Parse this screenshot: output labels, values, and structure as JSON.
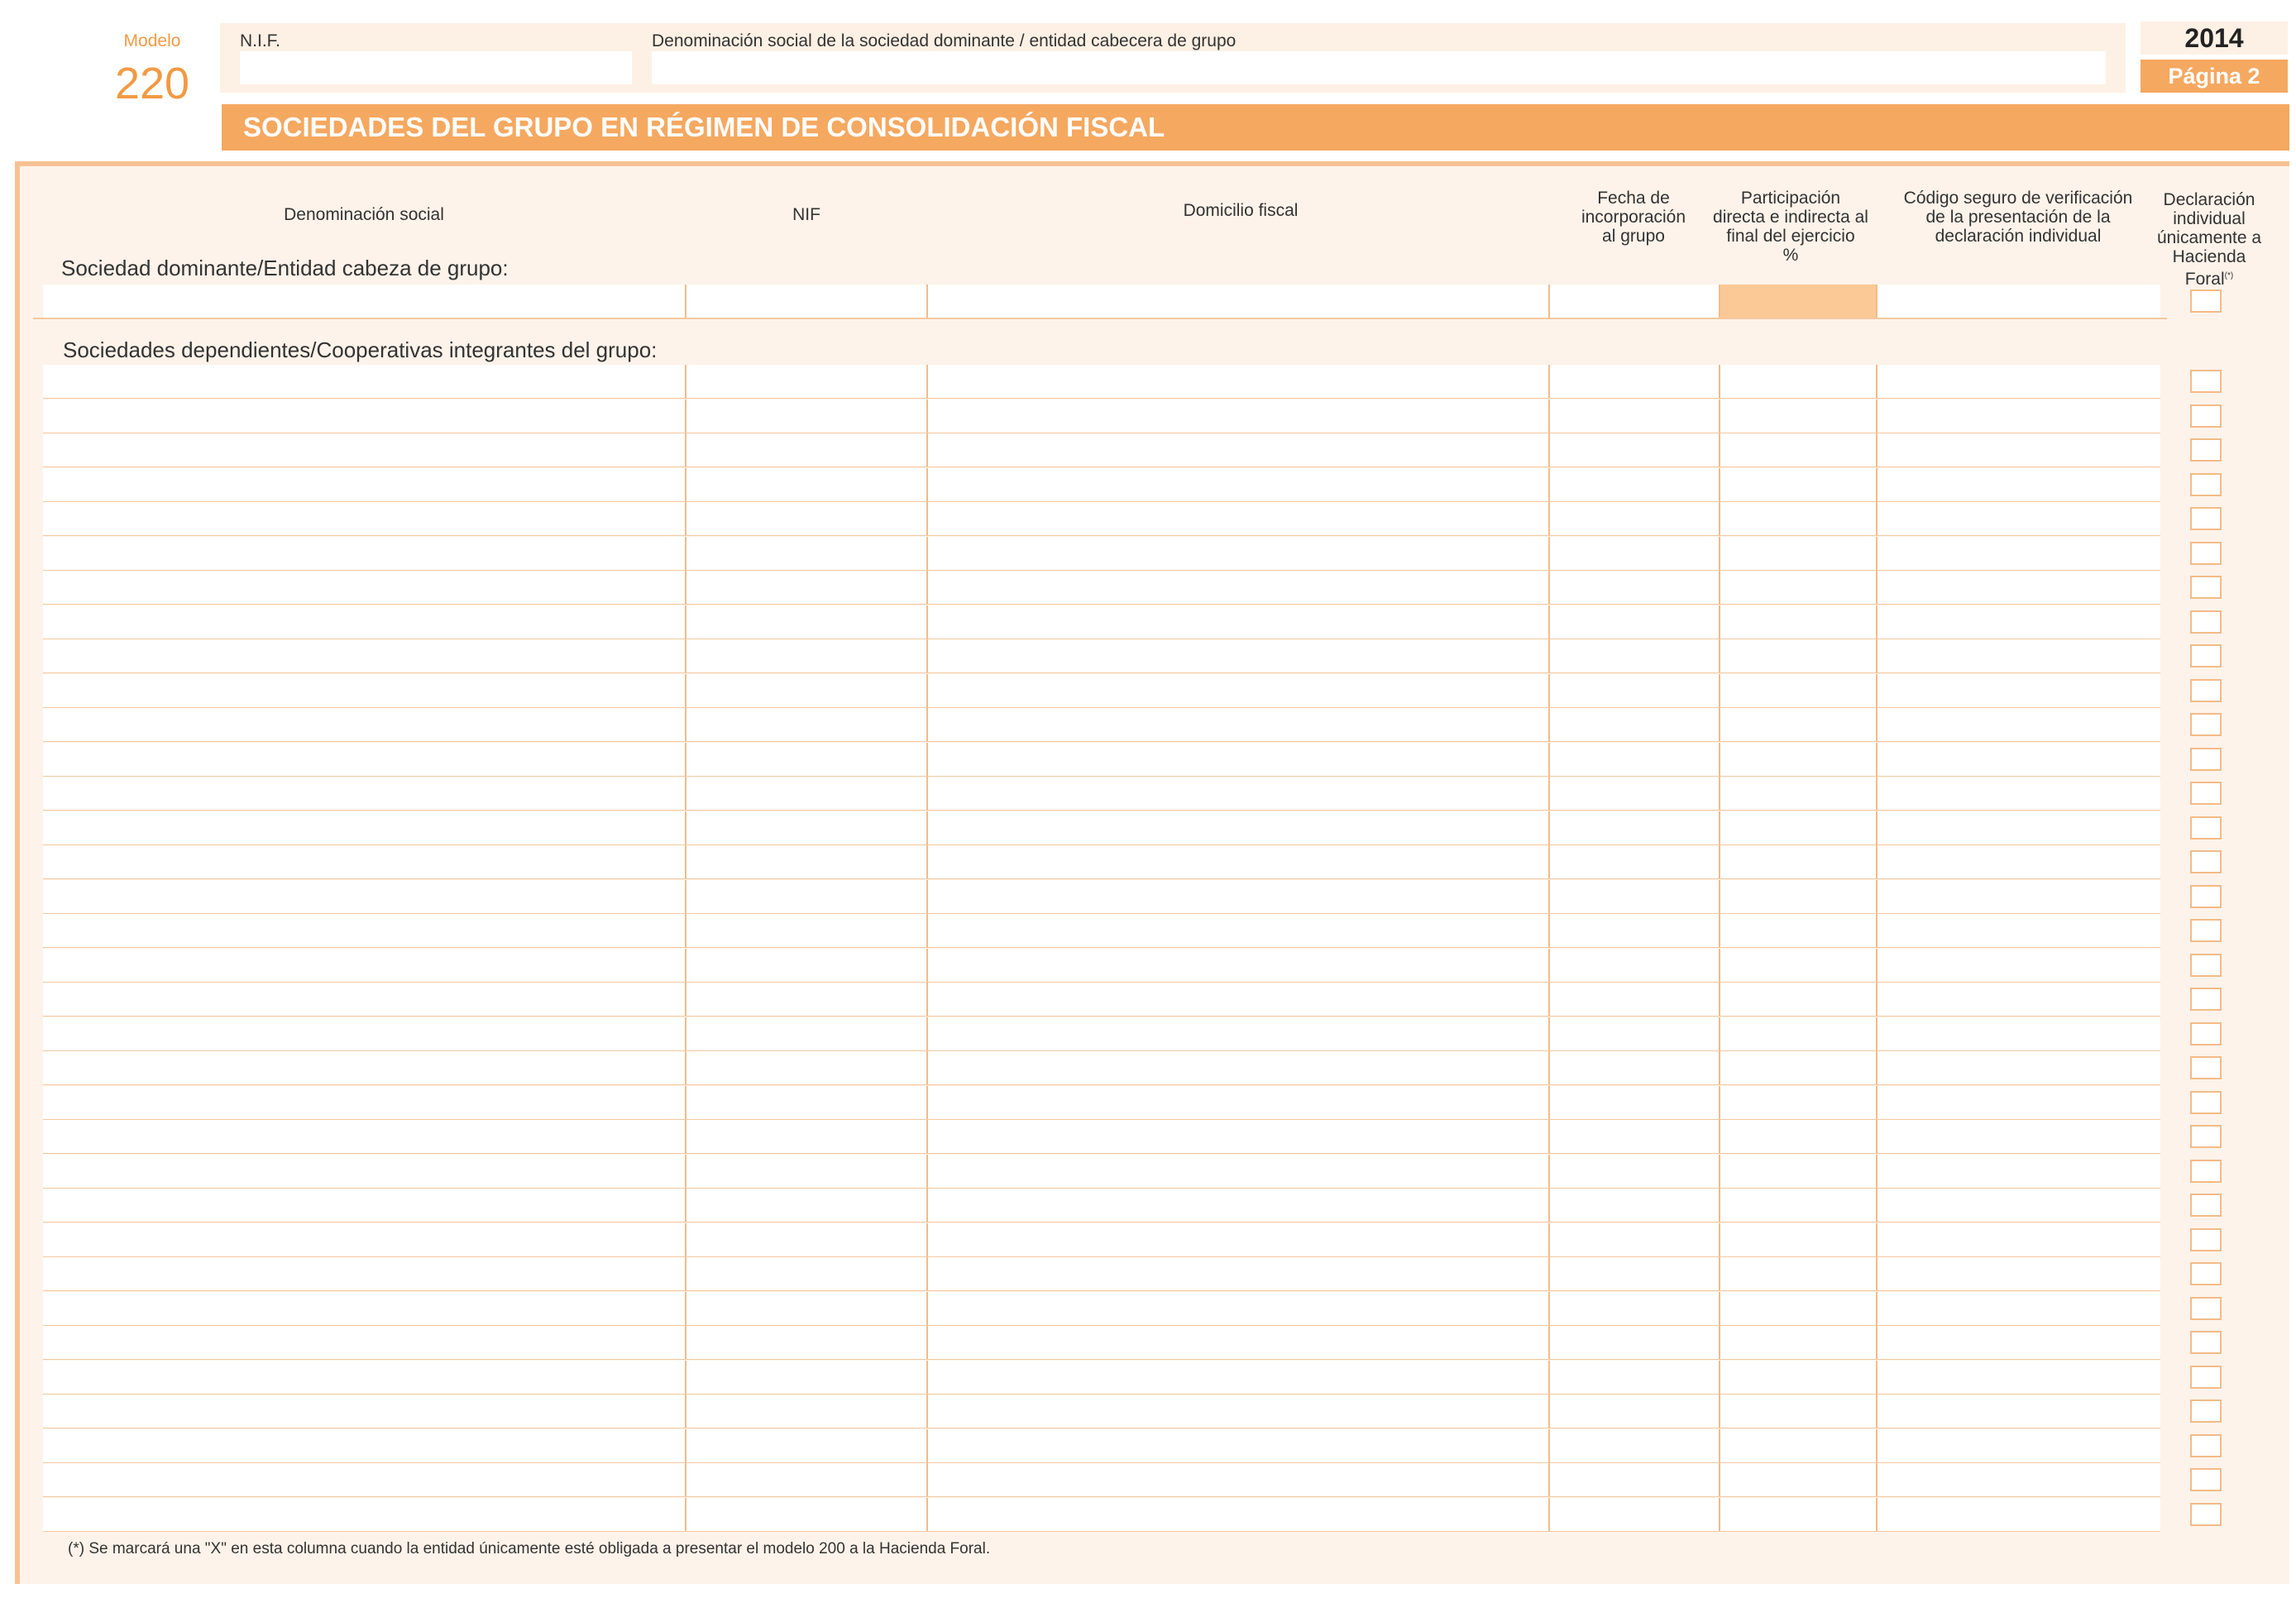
{
  "header": {
    "modelo_label": "Modelo",
    "modelo_number": "220",
    "nif_label": "N.I.F.",
    "nif_value": "",
    "denominacion_label": "Denominación social de la sociedad dominante / entidad cabecera de grupo",
    "denominacion_value": "",
    "year": "2014",
    "page": "Página 2",
    "title": "SOCIEDADES DEL GRUPO EN RÉGIMEN DE CONSOLIDACIÓN FISCAL"
  },
  "columns": [
    {
      "key": "denominacion",
      "label": "Denominación social"
    },
    {
      "key": "nif",
      "label": "NIF"
    },
    {
      "key": "domicilio",
      "label": "Domicilio fiscal"
    },
    {
      "key": "fecha",
      "label": "Fecha de\nincorporación\nal grupo"
    },
    {
      "key": "participacion",
      "label": "Participación\ndirecta e indirecta al\nfinal del ejercicio\n%"
    },
    {
      "key": "codigo",
      "label": "Código seguro de verificación\nde la presentación de la\ndeclaración individual"
    },
    {
      "key": "declaracion",
      "label": "Declaración\nindividual\núnicamente a\nHacienda Foral",
      "mark": "(*)"
    }
  ],
  "sections": {
    "dominante_label": "Sociedad dominante/Entidad cabeza de grupo:",
    "dependientes_label": "Sociedades dependientes/Cooperativas integrantes del grupo:"
  },
  "dependientes_row_count": 34,
  "footnote": "(*) Se marcará una \"X\" en esta columna cuando la entidad únicamente esté obligada a presentar el modelo 200 a la Hacienda Foral."
}
